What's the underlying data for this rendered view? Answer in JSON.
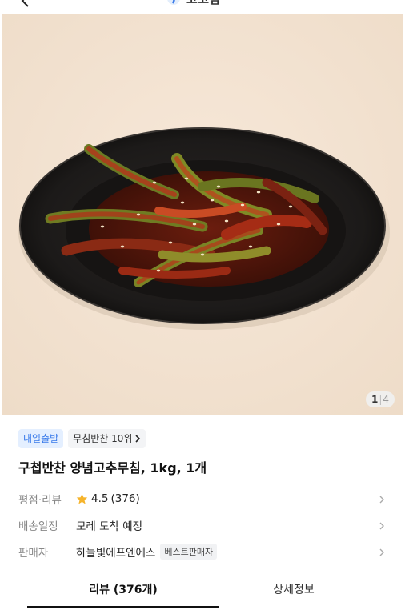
{
  "header": {
    "store_name": "고고삼"
  },
  "hero": {
    "page_current": "1",
    "page_total": "4"
  },
  "badges": {
    "delivery": "내일출발",
    "rank": "무침반찬 10위"
  },
  "product": {
    "title": "구첩반찬 양념고추무침, 1kg, 1개"
  },
  "info": {
    "rating_label": "평점·리뷰",
    "rating_value": "4.5",
    "review_count": "(376)",
    "shipping_label": "배송일정",
    "shipping_value": "모레 도착 예정",
    "seller_label": "판매자",
    "seller_name": "하늘빛에프엔에스",
    "seller_badge": "베스트판매자"
  },
  "tabs": {
    "reviews": "리뷰 (376개)",
    "details": "상세정보"
  },
  "colors": {
    "accent_blue": "#3a7bea",
    "star": "#f6b42b",
    "badge_bg": "#e4efff"
  },
  "icons": [
    "back-icon",
    "store-logo-icon",
    "chevron-right-icon",
    "star-icon"
  ]
}
